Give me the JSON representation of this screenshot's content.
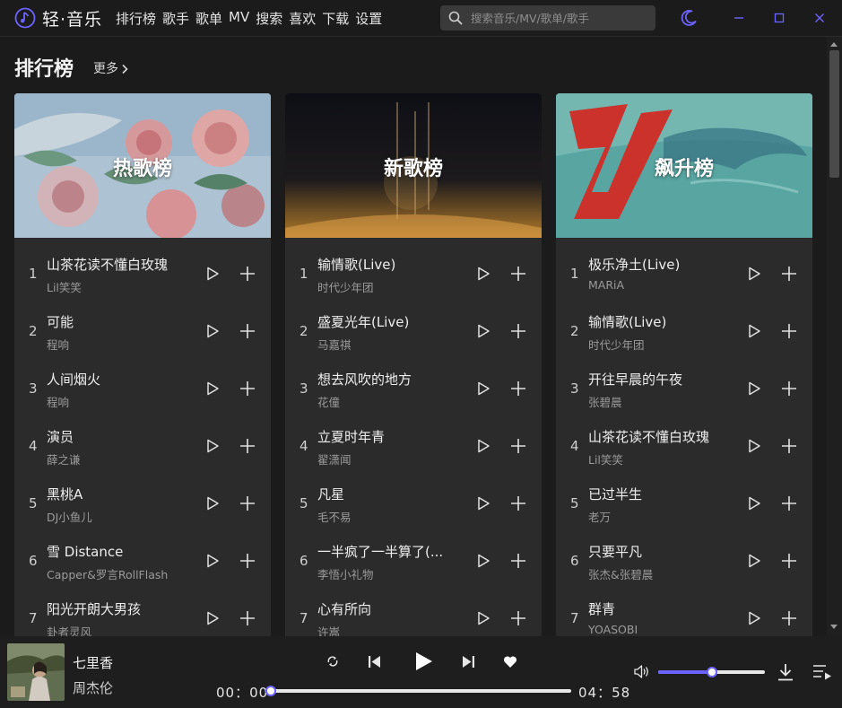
{
  "app": {
    "title": "轻·音乐"
  },
  "nav": {
    "items": [
      "排行榜",
      "歌手",
      "歌单",
      "MV",
      "搜索",
      "喜欢",
      "下载",
      "设置"
    ]
  },
  "search": {
    "placeholder": "搜索音乐/MV/歌单/歌手",
    "value": ""
  },
  "colors": {
    "accent": "#6c63ff",
    "background": "#1b1b1b",
    "card": "#2b2b2b"
  },
  "icons": {
    "logo": "music-note-circle-icon",
    "theme": "moon-icon",
    "window": [
      "minimize-icon",
      "maximize-icon",
      "close-icon"
    ],
    "row_actions": [
      "play-icon",
      "add-icon"
    ]
  },
  "section": {
    "title": "排行榜",
    "more_label": "更多"
  },
  "charts": [
    {
      "title": "热歌榜",
      "songs": [
        {
          "rank": "1",
          "title": "山茶花读不懂白玫瑰",
          "artist": "Lil笑笑"
        },
        {
          "rank": "2",
          "title": "可能",
          "artist": "程响"
        },
        {
          "rank": "3",
          "title": "人间烟火",
          "artist": "程响"
        },
        {
          "rank": "4",
          "title": "演员",
          "artist": "薛之谦"
        },
        {
          "rank": "5",
          "title": "黑桃A",
          "artist": "DJ小鱼儿"
        },
        {
          "rank": "6",
          "title": "雪 Distance",
          "artist": "Capper&罗言RollFlash"
        },
        {
          "rank": "7",
          "title": "阳光开朗大男孩",
          "artist": "卦者灵风"
        }
      ]
    },
    {
      "title": "新歌榜",
      "songs": [
        {
          "rank": "1",
          "title": "输情歌(Live)",
          "artist": "时代少年团"
        },
        {
          "rank": "2",
          "title": "盛夏光年(Live)",
          "artist": "马嘉祺"
        },
        {
          "rank": "3",
          "title": "想去风吹的地方",
          "artist": "花僮"
        },
        {
          "rank": "4",
          "title": "立夏时年青",
          "artist": "翟潇闻"
        },
        {
          "rank": "5",
          "title": "凡星",
          "artist": "毛不易"
        },
        {
          "rank": "6",
          "title": "一半疯了一半算了(...",
          "artist": "李悟小礼物"
        },
        {
          "rank": "7",
          "title": "心有所向",
          "artist": "许嵩"
        }
      ]
    },
    {
      "title": "飙升榜",
      "songs": [
        {
          "rank": "1",
          "title": "极乐净土(Live)",
          "artist": "MARiA"
        },
        {
          "rank": "2",
          "title": "输情歌(Live)",
          "artist": "时代少年团"
        },
        {
          "rank": "3",
          "title": "开往早晨的午夜",
          "artist": "张碧晨"
        },
        {
          "rank": "4",
          "title": "山茶花读不懂白玫瑰",
          "artist": "Lil笑笑"
        },
        {
          "rank": "5",
          "title": "已过半生",
          "artist": "老万"
        },
        {
          "rank": "6",
          "title": "只要平凡",
          "artist": "张杰&张碧晨"
        },
        {
          "rank": "7",
          "title": "群青",
          "artist": "YOASOBI"
        }
      ]
    }
  ],
  "player": {
    "title": "七里香",
    "artist": "周杰伦",
    "current_time": "00：00",
    "total_time": "04：58",
    "progress": 0.0,
    "volume": 0.5
  }
}
